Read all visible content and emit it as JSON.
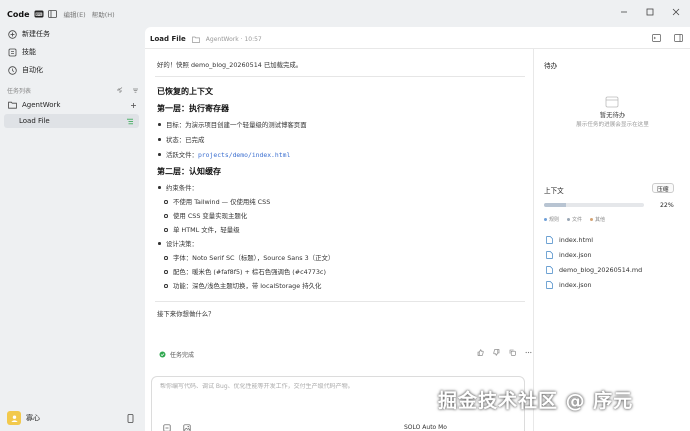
{
  "app": {
    "brand": "Code",
    "menu_edit": "编辑(E)",
    "menu_help": "帮助(H)"
  },
  "sidebar": {
    "items": [
      {
        "label": "新建任务"
      },
      {
        "label": "技能"
      },
      {
        "label": "自动化"
      }
    ],
    "section_label": "任务列表",
    "project": "AgentWork",
    "active_task": "Load File",
    "user_name": "寡心"
  },
  "tab": {
    "title": "Load File",
    "subtitle": "AgentWork · 10:57"
  },
  "chat": {
    "lines": [
      {
        "kind": "p",
        "text": "好的！快照 demo_blog_20260514 已加载完成。"
      },
      {
        "kind": "h2",
        "text": "已恢复的上下文"
      },
      {
        "kind": "h2",
        "text": "第一层：执行寄存器"
      },
      {
        "kind": "b1",
        "text": "目标：为演示项目创建一个轻量级的测试博客页面"
      },
      {
        "kind": "b1",
        "text": "状态：已完成"
      },
      {
        "kind": "b1",
        "text": "活跃文件：",
        "code": "projects/demo/index.html"
      },
      {
        "kind": "h2",
        "text": "第二层：认知缓存"
      },
      {
        "kind": "b1",
        "text": "约束条件："
      },
      {
        "kind": "b2",
        "text": "不使用 Tailwind — 仅使用纯 CSS"
      },
      {
        "kind": "b2",
        "text": "使用 CSS 变量实现主题化"
      },
      {
        "kind": "b2",
        "text": "单 HTML 文件，轻量级"
      },
      {
        "kind": "b1",
        "text": "设计决策："
      },
      {
        "kind": "b2",
        "text": "字体：Noto Serif SC（标题），Source Sans 3（正文）"
      },
      {
        "kind": "b2",
        "text": "配色：暖米色 (#faf8f5) + 棕石色强调色 (#c4773c)"
      },
      {
        "kind": "b2",
        "text": "功能：深色/浅色主题切换，带 localStorage 持久化"
      },
      {
        "kind": "p",
        "text": "接下来你想做什么？"
      }
    ],
    "status": "任务完成"
  },
  "input": {
    "placeholder": "帮你编写代码、调试 Bug、优化性能等开发工作，交付生产级代码产物。",
    "mode": "SOLO Auto Mo"
  },
  "right_panel": {
    "todo_title": "待办",
    "empty_title": "暂无待办",
    "empty_sub": "展示任务的进展会显示在这里",
    "context_title": "上下文",
    "compress_label": "压缩",
    "context_percent": "22%",
    "context_fraction": 0.22,
    "legend": [
      "规则",
      "文件",
      "其他"
    ],
    "legend_colors": [
      "#6fa0d8",
      "#9aa7b5",
      "#d4a373"
    ],
    "files": [
      "index.html",
      "index.json",
      "demo_blog_20260514.md",
      "index.json"
    ]
  },
  "watermark": "掘金技术社区 @ 序元",
  "colors": {
    "accent": "#3b6fd0",
    "success": "#2fa84f",
    "file_icon": "#3b82c4"
  }
}
